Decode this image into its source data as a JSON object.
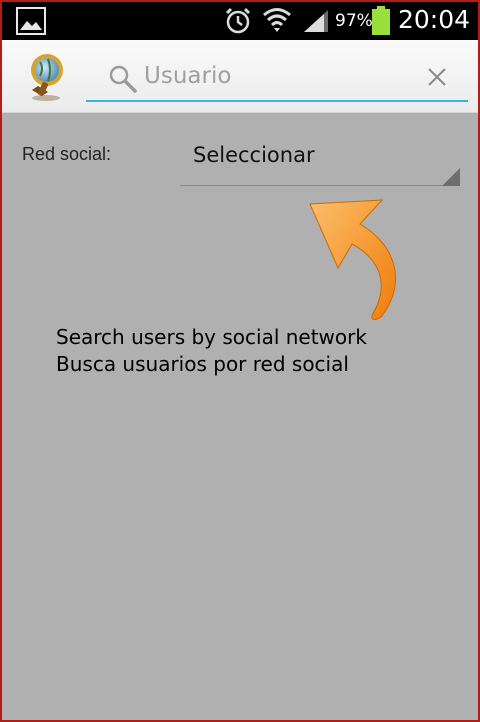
{
  "status_bar": {
    "battery_percent": "97%",
    "time": "20:04",
    "icons": [
      "gallery-icon",
      "alarm-icon",
      "wifi-icon",
      "signal-icon",
      "battery-icon"
    ]
  },
  "action_bar": {
    "app_icon": "globe-magnifier-icon",
    "search": {
      "placeholder": "Usuario",
      "value": ""
    },
    "clear_icon": "close-icon",
    "accent_color": "#33b5e5"
  },
  "form": {
    "social_label": "Red social:",
    "social_select": {
      "selected": "Seleccionar"
    }
  },
  "hint": {
    "line_en": "Search users by social network",
    "line_es": "Busca usuarios por red social",
    "arrow_color": "#f7941d"
  },
  "colors": {
    "background": "#b0b0b0",
    "frame_border": "#b81a1a"
  }
}
